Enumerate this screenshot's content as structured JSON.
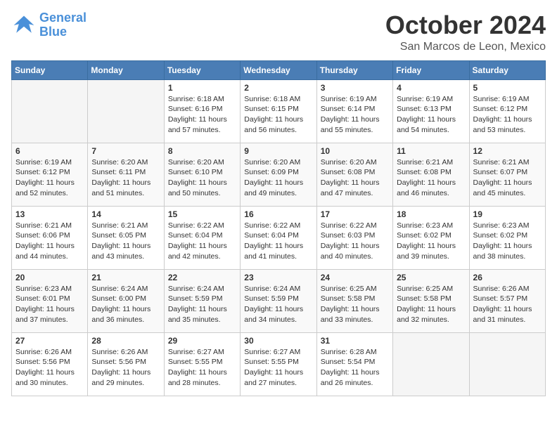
{
  "logo": {
    "line1": "General",
    "line2": "Blue"
  },
  "title": "October 2024",
  "location": "San Marcos de Leon, Mexico",
  "weekdays": [
    "Sunday",
    "Monday",
    "Tuesday",
    "Wednesday",
    "Thursday",
    "Friday",
    "Saturday"
  ],
  "weeks": [
    [
      {
        "day": "",
        "info": ""
      },
      {
        "day": "",
        "info": ""
      },
      {
        "day": "1",
        "info": "Sunrise: 6:18 AM\nSunset: 6:16 PM\nDaylight: 11 hours and 57 minutes."
      },
      {
        "day": "2",
        "info": "Sunrise: 6:18 AM\nSunset: 6:15 PM\nDaylight: 11 hours and 56 minutes."
      },
      {
        "day": "3",
        "info": "Sunrise: 6:19 AM\nSunset: 6:14 PM\nDaylight: 11 hours and 55 minutes."
      },
      {
        "day": "4",
        "info": "Sunrise: 6:19 AM\nSunset: 6:13 PM\nDaylight: 11 hours and 54 minutes."
      },
      {
        "day": "5",
        "info": "Sunrise: 6:19 AM\nSunset: 6:12 PM\nDaylight: 11 hours and 53 minutes."
      }
    ],
    [
      {
        "day": "6",
        "info": "Sunrise: 6:19 AM\nSunset: 6:12 PM\nDaylight: 11 hours and 52 minutes."
      },
      {
        "day": "7",
        "info": "Sunrise: 6:20 AM\nSunset: 6:11 PM\nDaylight: 11 hours and 51 minutes."
      },
      {
        "day": "8",
        "info": "Sunrise: 6:20 AM\nSunset: 6:10 PM\nDaylight: 11 hours and 50 minutes."
      },
      {
        "day": "9",
        "info": "Sunrise: 6:20 AM\nSunset: 6:09 PM\nDaylight: 11 hours and 49 minutes."
      },
      {
        "day": "10",
        "info": "Sunrise: 6:20 AM\nSunset: 6:08 PM\nDaylight: 11 hours and 47 minutes."
      },
      {
        "day": "11",
        "info": "Sunrise: 6:21 AM\nSunset: 6:08 PM\nDaylight: 11 hours and 46 minutes."
      },
      {
        "day": "12",
        "info": "Sunrise: 6:21 AM\nSunset: 6:07 PM\nDaylight: 11 hours and 45 minutes."
      }
    ],
    [
      {
        "day": "13",
        "info": "Sunrise: 6:21 AM\nSunset: 6:06 PM\nDaylight: 11 hours and 44 minutes."
      },
      {
        "day": "14",
        "info": "Sunrise: 6:21 AM\nSunset: 6:05 PM\nDaylight: 11 hours and 43 minutes."
      },
      {
        "day": "15",
        "info": "Sunrise: 6:22 AM\nSunset: 6:04 PM\nDaylight: 11 hours and 42 minutes."
      },
      {
        "day": "16",
        "info": "Sunrise: 6:22 AM\nSunset: 6:04 PM\nDaylight: 11 hours and 41 minutes."
      },
      {
        "day": "17",
        "info": "Sunrise: 6:22 AM\nSunset: 6:03 PM\nDaylight: 11 hours and 40 minutes."
      },
      {
        "day": "18",
        "info": "Sunrise: 6:23 AM\nSunset: 6:02 PM\nDaylight: 11 hours and 39 minutes."
      },
      {
        "day": "19",
        "info": "Sunrise: 6:23 AM\nSunset: 6:02 PM\nDaylight: 11 hours and 38 minutes."
      }
    ],
    [
      {
        "day": "20",
        "info": "Sunrise: 6:23 AM\nSunset: 6:01 PM\nDaylight: 11 hours and 37 minutes."
      },
      {
        "day": "21",
        "info": "Sunrise: 6:24 AM\nSunset: 6:00 PM\nDaylight: 11 hours and 36 minutes."
      },
      {
        "day": "22",
        "info": "Sunrise: 6:24 AM\nSunset: 5:59 PM\nDaylight: 11 hours and 35 minutes."
      },
      {
        "day": "23",
        "info": "Sunrise: 6:24 AM\nSunset: 5:59 PM\nDaylight: 11 hours and 34 minutes."
      },
      {
        "day": "24",
        "info": "Sunrise: 6:25 AM\nSunset: 5:58 PM\nDaylight: 11 hours and 33 minutes."
      },
      {
        "day": "25",
        "info": "Sunrise: 6:25 AM\nSunset: 5:58 PM\nDaylight: 11 hours and 32 minutes."
      },
      {
        "day": "26",
        "info": "Sunrise: 6:26 AM\nSunset: 5:57 PM\nDaylight: 11 hours and 31 minutes."
      }
    ],
    [
      {
        "day": "27",
        "info": "Sunrise: 6:26 AM\nSunset: 5:56 PM\nDaylight: 11 hours and 30 minutes."
      },
      {
        "day": "28",
        "info": "Sunrise: 6:26 AM\nSunset: 5:56 PM\nDaylight: 11 hours and 29 minutes."
      },
      {
        "day": "29",
        "info": "Sunrise: 6:27 AM\nSunset: 5:55 PM\nDaylight: 11 hours and 28 minutes."
      },
      {
        "day": "30",
        "info": "Sunrise: 6:27 AM\nSunset: 5:55 PM\nDaylight: 11 hours and 27 minutes."
      },
      {
        "day": "31",
        "info": "Sunrise: 6:28 AM\nSunset: 5:54 PM\nDaylight: 11 hours and 26 minutes."
      },
      {
        "day": "",
        "info": ""
      },
      {
        "day": "",
        "info": ""
      }
    ]
  ]
}
